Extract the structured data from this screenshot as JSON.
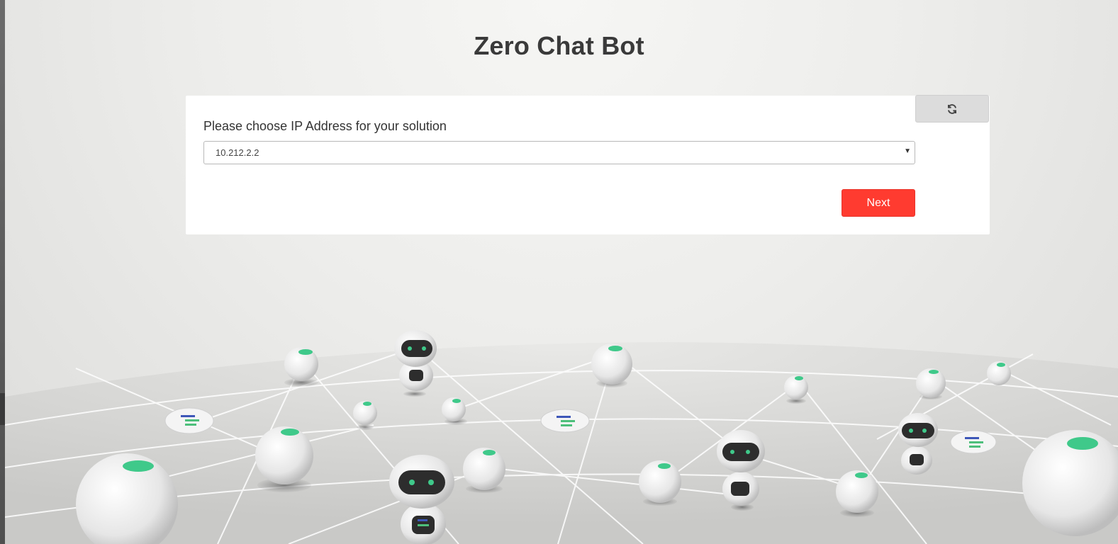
{
  "page": {
    "title": "Zero Chat Bot"
  },
  "form": {
    "label": "Please choose IP Address for your solution",
    "ip_select": {
      "selected": "10.212.2.2"
    },
    "next_label": "Next",
    "refresh_icon": "refresh-icon"
  },
  "colors": {
    "accent": "#ff3b30",
    "refresh_bg": "#dcdcdc",
    "card_bg": "#ffffff"
  }
}
